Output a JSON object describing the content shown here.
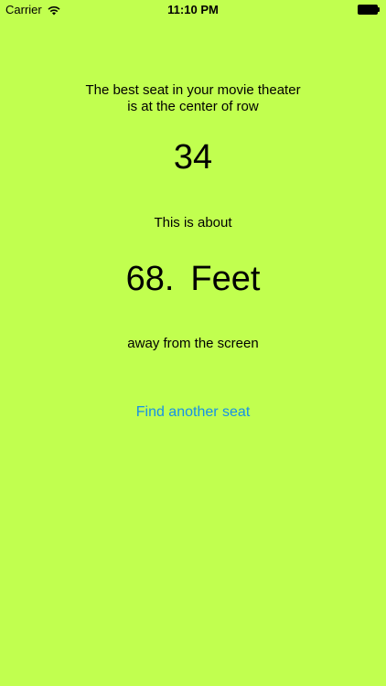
{
  "status_bar": {
    "carrier": "Carrier",
    "time": "11:10 PM",
    "wifi_icon": "wifi-icon",
    "battery_icon": "battery-icon"
  },
  "main": {
    "headline_line1": "The best seat in your movie theater",
    "headline_line2": "is at the center of row",
    "row_number": "34",
    "about_text": "This is about",
    "distance_value": "68.",
    "distance_unit": "Feet",
    "away_text": "away from the screen",
    "find_button_label": "Find another seat"
  },
  "colors": {
    "background": "#c1ff4f",
    "text": "#000000",
    "link": "#1691e6"
  }
}
